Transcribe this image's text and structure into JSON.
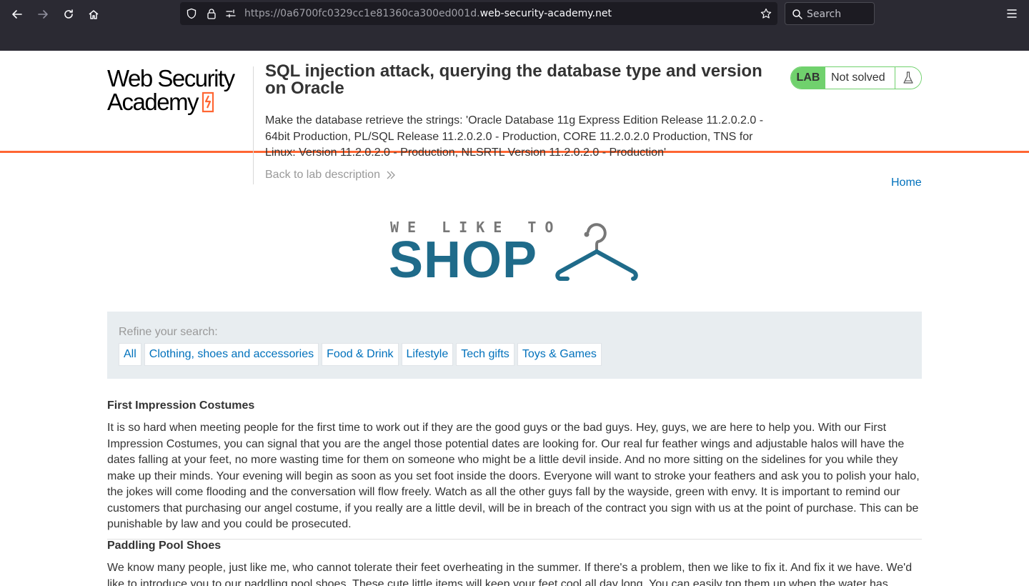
{
  "browser": {
    "url_prefix": "https://0a6700fc0329cc1e81360ca300ed001d.",
    "url_domain": "web-security-academy.net",
    "search_placeholder": "Search"
  },
  "header": {
    "logo_line1": "Web Security",
    "logo_line2": "Academy",
    "lab_title": "SQL injection attack, querying the database type and version on Oracle",
    "lab_description": "Make the database retrieve the strings: 'Oracle Database 11g Express Edition Release 11.2.0.2.0 - 64bit Production, PL/SQL Release 11.2.0.2.0 - Production, CORE 11.2.0.2.0 Production, TNS for Linux: Version 11.2.0.2.0 - Production, NLSRTL Version 11.2.0.2.0 - Production'",
    "back_link": "Back to lab description",
    "status_tag": "LAB",
    "status_text": "Not solved"
  },
  "nav": {
    "home": "Home"
  },
  "shop_logo": {
    "tagline": "WE LIKE TO",
    "word": "SHOP"
  },
  "filters": {
    "label": "Refine your search:",
    "categories": [
      "All",
      "Clothing, shoes and accessories",
      "Food & Drink",
      "Lifestyle",
      "Tech gifts",
      "Toys & Games"
    ]
  },
  "products": [
    {
      "name": "First Impression Costumes",
      "description": "It is so hard when meeting people for the first time to work out if they are the good guys or the bad guys. Hey, guys, we are here to help you. With our First Impression Costumes, you can signal that you are the angel those potential dates are looking for. Our real fur feather wings and adjustable halos will have the dates falling at your feet, no more wasting time for them on someone who might be a little devil inside. And no more sitting on the sidelines for you while they make up their minds. Your evening will begin as soon as you set foot inside the doors. Everyone will want to stroke your feathers and ask you to polish your halo, the jokes will come flooding and the conversation will flow freely. Watch as all the other guys fall by the wayside, green with envy. It is important to remind our customers that purchasing our angel costume, if you really are a little devil, will be in breach of the contract you sign with us at the point of purchase. This can be punishable by law and you could be prosecuted."
    },
    {
      "name": "Paddling Pool Shoes",
      "description": "We know many people, just like me, who cannot tolerate their feet overheating in the summer. If there's a problem, then we like to fix it. And fix it we have. We'd like to introduce you to our paddling pool shoes. These cute little items will keep your feet cool all day long. You can easily top them up when the water has"
    }
  ],
  "colors": {
    "accent_orange": "#ff6633",
    "link_blue": "#0071bc",
    "lab_green": "#70d16d",
    "shop_blue": "#1f6b8a"
  }
}
